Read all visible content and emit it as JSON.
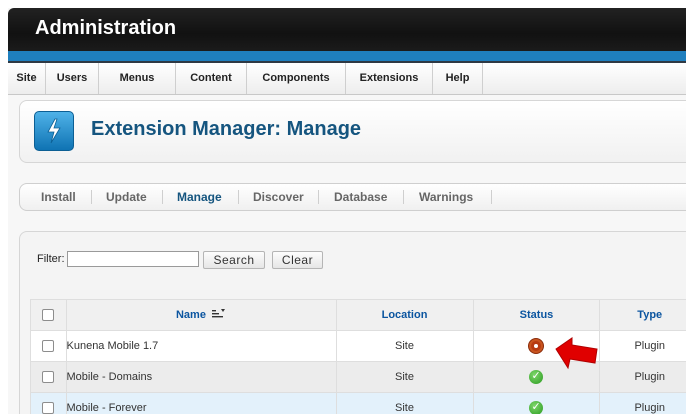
{
  "header": {
    "title": "Administration"
  },
  "menu": {
    "items": [
      "Site",
      "Users",
      "Menus",
      "Content",
      "Components",
      "Extensions",
      "Help"
    ]
  },
  "page": {
    "title": "Extension Manager: Manage",
    "icon": "lightning-bolt-icon"
  },
  "tabs": {
    "items": [
      "Install",
      "Update",
      "Manage",
      "Discover",
      "Database",
      "Warnings"
    ],
    "active": "Manage"
  },
  "filter": {
    "label": "Filter:",
    "value": "",
    "search_label": "Search",
    "clear_label": "Clear"
  },
  "table": {
    "columns": {
      "name": "Name",
      "location": "Location",
      "status": "Status",
      "type": "Type"
    },
    "rows": [
      {
        "name": "Kunena Mobile 1.7",
        "location": "Site",
        "status": "disabled",
        "type": "Plugin"
      },
      {
        "name": "Mobile - Domains",
        "location": "Site",
        "status": "enabled",
        "type": "Plugin"
      },
      {
        "name": "Mobile - Forever",
        "location": "Site",
        "status": "enabled",
        "type": "Plugin"
      }
    ]
  },
  "colors": {
    "accent_blue": "#1f7fbe",
    "title_blue": "#15557f",
    "header_link": "#0b55a0",
    "status_disabled": "#b73b12",
    "status_enabled": "#2a9a1f",
    "annotation_arrow": "#e00000"
  },
  "annotation": {
    "icon": "red-arrow-icon"
  }
}
